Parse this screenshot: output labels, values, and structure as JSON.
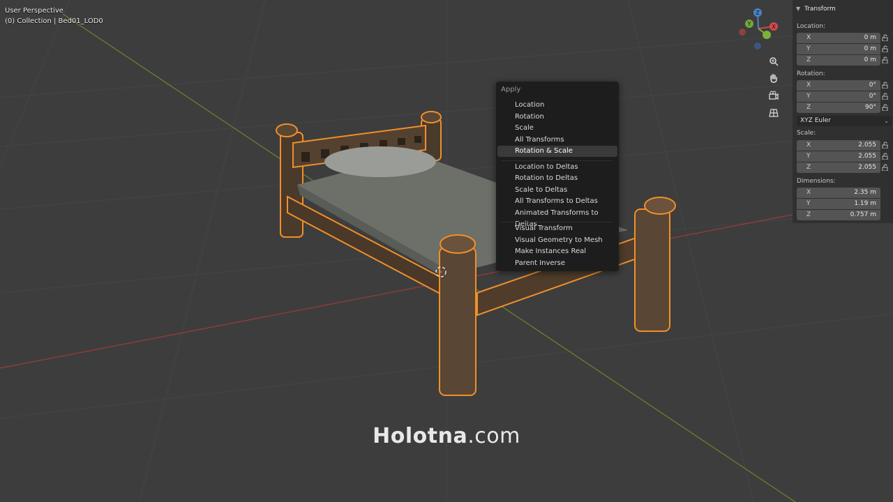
{
  "viewport": {
    "perspective_label": "User Perspective",
    "collection_label": "(0) Collection | Bed01_LOD0"
  },
  "context_menu": {
    "title": "Apply",
    "items": [
      {
        "label": "Location"
      },
      {
        "label": "Rotation"
      },
      {
        "label": "Scale"
      },
      {
        "label": "All Transforms"
      },
      {
        "label": "Rotation & Scale",
        "active": true
      },
      {
        "label": "Location to Deltas"
      },
      {
        "label": "Rotation to Deltas"
      },
      {
        "label": "Scale to Deltas"
      },
      {
        "label": "All Transforms to Deltas"
      },
      {
        "label": "Animated Transforms to Deltas"
      },
      {
        "label": "Visual Transform"
      },
      {
        "label": "Visual Geometry to Mesh"
      },
      {
        "label": "Make Instances Real"
      },
      {
        "label": "Parent Inverse"
      }
    ]
  },
  "gizmo": {
    "x": "X",
    "y": "Y",
    "z": "Z"
  },
  "nav_buttons": [
    "zoom-icon",
    "hand-icon",
    "camera-icon",
    "grid-icon"
  ],
  "transform_panel": {
    "title": "Transform",
    "location": {
      "label": "Location:",
      "x": "0 m",
      "y": "0 m",
      "z": "0 m"
    },
    "rotation": {
      "label": "Rotation:",
      "x": "0°",
      "y": "0°",
      "z": "90°"
    },
    "rotation_mode": "XYZ Euler",
    "scale": {
      "label": "Scale:",
      "x": "2.055",
      "y": "2.055",
      "z": "2.055"
    },
    "dimensions": {
      "label": "Dimensions:",
      "x": "2.35 m",
      "y": "1.19 m",
      "z": "0.757 m"
    },
    "axis_labels": {
      "x": "X",
      "y": "Y",
      "z": "Z"
    }
  },
  "watermark": {
    "bold": "Holotna",
    "light": ".com"
  },
  "colors": {
    "background": "#3d3d3d",
    "selection_outline": "#f0902a",
    "axis_x": "#a03a3a",
    "axis_y": "#6a8a2a",
    "menu_bg": "#1d1d1d"
  }
}
